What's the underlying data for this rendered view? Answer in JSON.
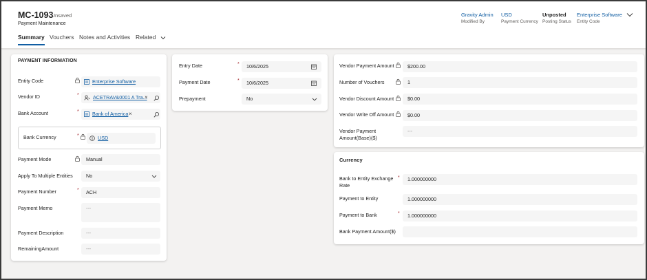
{
  "record": {
    "id": "MC-1093",
    "status": "- Unsaved",
    "subtitle": "Payment Maintenance"
  },
  "header_fields": [
    {
      "value": "Gravity Admin",
      "label": "Modified By"
    },
    {
      "value": "USD",
      "label": "Payment Currency"
    },
    {
      "value": "Unposted",
      "label": "Posting Status"
    },
    {
      "value": "Enterprise Software",
      "label": "Entity Code"
    }
  ],
  "tabs": [
    "Summary",
    "Vouchers",
    "Notes and Activities",
    "Related"
  ],
  "payment_info": {
    "title": "PAYMENT INFORMATION",
    "entity_code": {
      "label": "Entity Code",
      "value": "Enterprise Software"
    },
    "vendor_id": {
      "label": "Vendor ID",
      "value": "ACETRAV&0001 A Tra..."
    },
    "bank_account": {
      "label": "Bank Account",
      "value": "Bank of America"
    },
    "bank_currency": {
      "label": "Bank Currency",
      "value": "USD"
    },
    "payment_mode": {
      "label": "Payment Mode",
      "value": "Manual"
    },
    "apply_multi": {
      "label": "Apply To Multiple Entities",
      "value": "No"
    },
    "payment_number": {
      "label": "Payment Number",
      "value": "ACH"
    },
    "payment_memo": {
      "label": "Payment Memo",
      "value": "---"
    },
    "payment_description": {
      "label": "Payment Description",
      "value": "---"
    },
    "remaining_amount": {
      "label": "RemainingAmount",
      "value": "---"
    }
  },
  "dates": {
    "entry_date": {
      "label": "Entry Date",
      "value": "10/6/2025"
    },
    "payment_date": {
      "label": "Payment Date",
      "value": "10/6/2025"
    },
    "prepayment": {
      "label": "Prepayment",
      "value": "No"
    }
  },
  "amounts": {
    "vendor_payment_amount": {
      "label": "Vendor Payment Amount",
      "value": "$200.00"
    },
    "number_of_vouchers": {
      "label": "Number of Vouchers",
      "value": "1"
    },
    "vendor_discount_amount": {
      "label": "Vendor Discount Amount",
      "value": "$0.00"
    },
    "vendor_write_off_amount": {
      "label": "Vendor Write Off Amount",
      "value": "$0.00"
    },
    "vendor_payment_base": {
      "label1": "Vendor Payment",
      "label2": "Amount(Base)($)",
      "value": "---"
    }
  },
  "currency": {
    "title": "Currency",
    "bank_to_entity_rate": {
      "label1": "Bank to Entity Exchange",
      "label2": "Rate",
      "value": "1.000000000"
    },
    "payment_to_entity": {
      "label": "Payment to Entity",
      "value": "1.000000000"
    },
    "payment_to_bank": {
      "label": "Payment to Bank",
      "value": "1.000000000"
    },
    "bank_payment_amount": {
      "label": "Bank Payment Amount($)",
      "value": ""
    }
  },
  "required_mark": "*",
  "remove_mark": "×",
  "colors": {
    "accent": "#115ea3",
    "required": "#a4262c",
    "field_bg": "#f5f5f5",
    "page_bg": "#f3f2f1"
  }
}
